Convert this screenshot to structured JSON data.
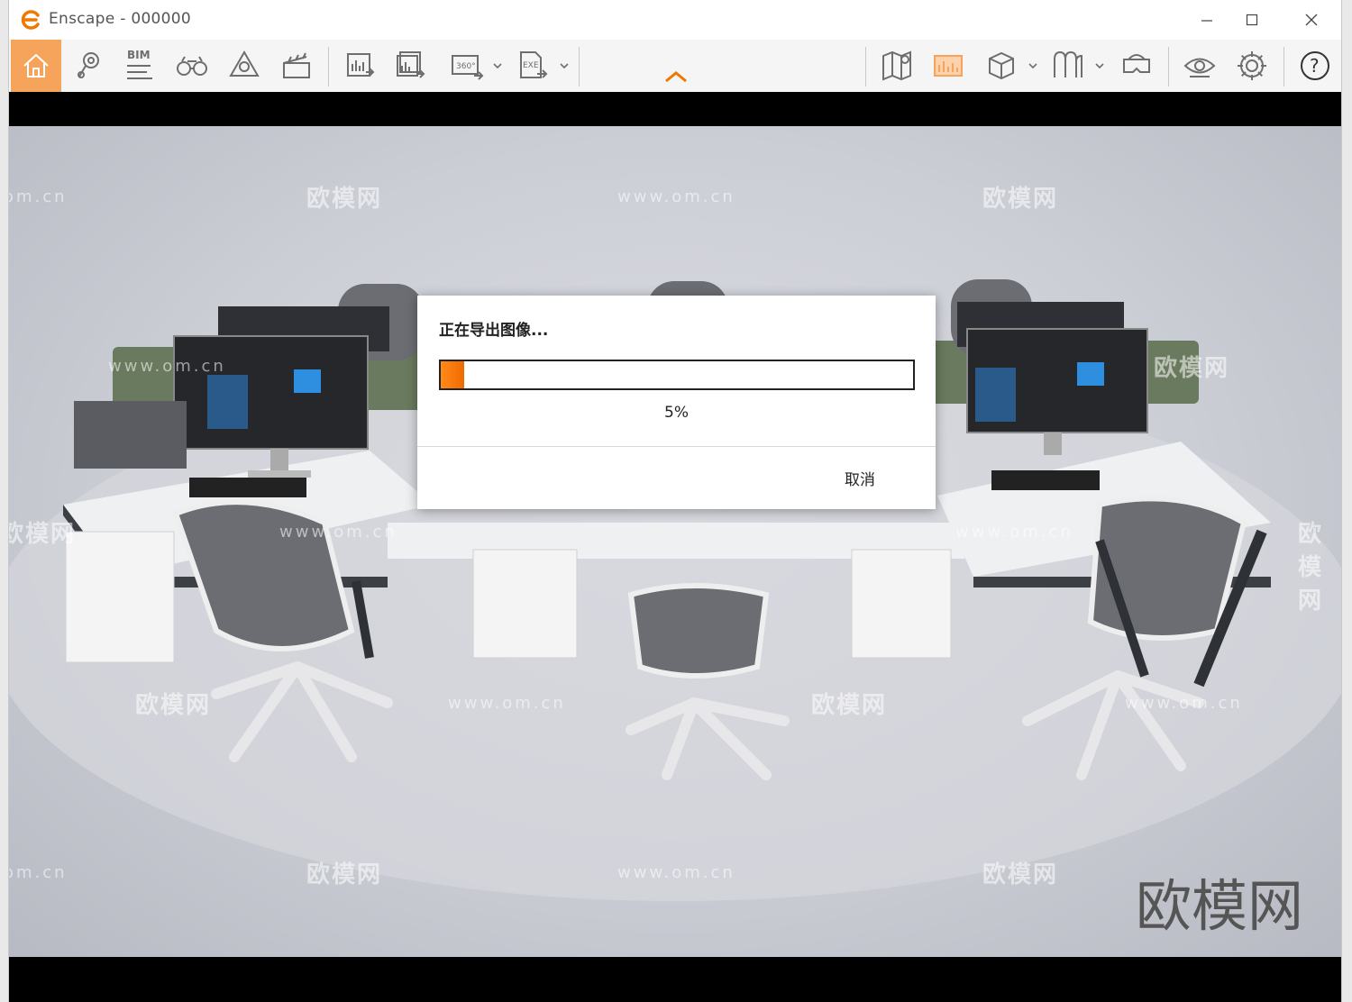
{
  "window": {
    "title": "Enscape - 000000"
  },
  "toolbar": {
    "bim_label": "BIM",
    "pano_label": "360°",
    "exe_label": "EXE",
    "help_label": "?"
  },
  "dialog": {
    "title": "正在导出图像...",
    "progress_text": "5%",
    "progress_value": 5,
    "cancel_label": "取消"
  },
  "watermarks": {
    "brand": "欧模网",
    "url": "www.om.cn",
    "url_partial": "om.cn",
    "brand_corner": "欧模网"
  },
  "colors": {
    "accent": "#f28c28",
    "progress": "#f07800"
  }
}
